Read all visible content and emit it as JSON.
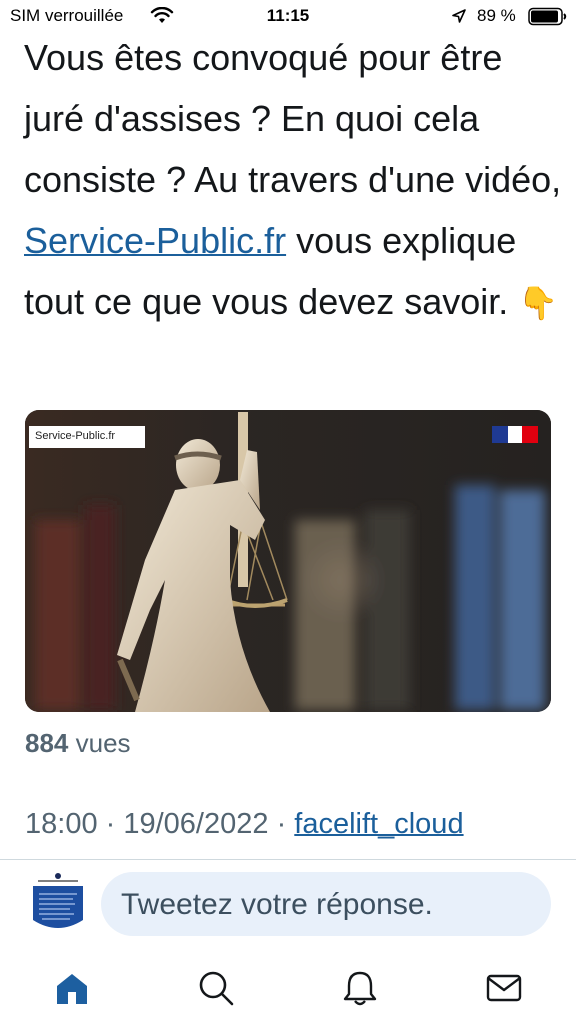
{
  "status_bar": {
    "carrier": "SIM verrouillée",
    "time": "11:15",
    "battery_pct": "89 %"
  },
  "tweet": {
    "text_before_link": "Vous êtes convoqué pour être juré d'assises ? En quoi cela consiste ? Au travers d'une vidéo, ",
    "link_text": "Service-Public.fr",
    "text_after_link": " vous explique tout ce que vous devez savoir. ",
    "emoji": "👇"
  },
  "media": {
    "badge": "Service-Public.fr",
    "badge_icon": "gov-logo-icon",
    "flag_icon": "french-flag-icon"
  },
  "stats": {
    "views_count": "884",
    "views_label": "vues"
  },
  "meta": {
    "time": "18:00",
    "sep1": " · ",
    "date": "19/06/2022",
    "sep2": " · ",
    "source": "facelift_cloud"
  },
  "reply": {
    "placeholder": "Tweetez votre réponse."
  },
  "tabs": [
    {
      "icon": "home-icon",
      "active": true
    },
    {
      "icon": "search-icon",
      "active": false
    },
    {
      "icon": "bell-icon",
      "active": false
    },
    {
      "icon": "mail-icon",
      "active": false
    }
  ],
  "colors": {
    "link": "#1b5f9b",
    "text": "#14171a",
    "secondary": "#536471",
    "reply_bg": "#e8f0fa",
    "active_tab": "#1d5fa0"
  }
}
